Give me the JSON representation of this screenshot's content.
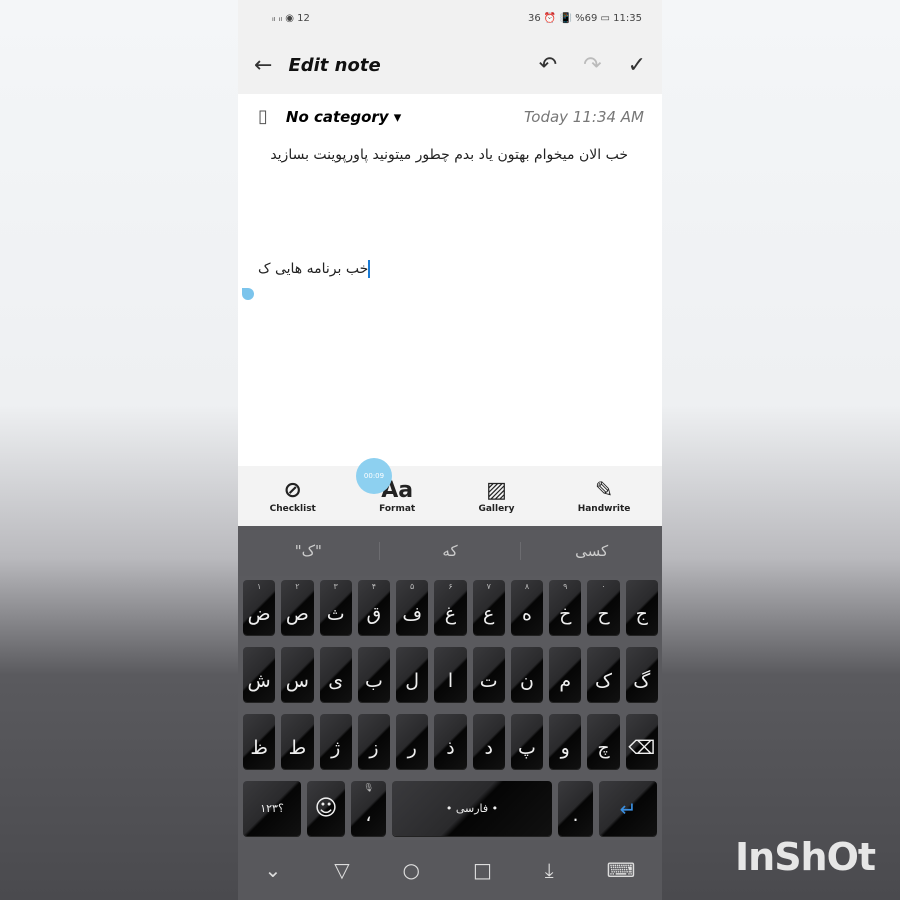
{
  "status": {
    "left": "ᵢₗ ᵢₗ ◉ 12",
    "right": "36 ⏰ 📳 %69 ▭ 11:35"
  },
  "toolbar": {
    "title": "Edit note",
    "back_icon": "arrow-left-icon",
    "undo_icon": "undo-icon",
    "redo_icon": "redo-icon",
    "save_icon": "check-icon"
  },
  "meta": {
    "category": "No category",
    "date": "Today 11:34 AM"
  },
  "note": {
    "line1": "خب الان میخوام بهتون یاد بدم چطور میتونید پاورپوینت بسازید",
    "line2": "خب برنامه هایی ک"
  },
  "tools": [
    {
      "label": "Checklist",
      "icon": "☑"
    },
    {
      "label": "Format",
      "icon": "Aa"
    },
    {
      "label": "Gallery",
      "icon": "🖼"
    },
    {
      "label": "Handwrite",
      "icon": "✎"
    }
  ],
  "bubble": "00:09",
  "suggestions": [
    "\"ک\"",
    "که",
    "کسی"
  ],
  "keyboard": {
    "row1": [
      {
        "k": "ض",
        "n": "۱"
      },
      {
        "k": "ص",
        "n": "۲"
      },
      {
        "k": "ث",
        "n": "۳"
      },
      {
        "k": "ق",
        "n": "۴"
      },
      {
        "k": "ف",
        "n": "۵"
      },
      {
        "k": "غ",
        "n": "۶"
      },
      {
        "k": "ع",
        "n": "۷"
      },
      {
        "k": "ه",
        "n": "۸"
      },
      {
        "k": "خ",
        "n": "۹"
      },
      {
        "k": "ح",
        "n": "۰"
      },
      {
        "k": "ج",
        "n": ""
      }
    ],
    "row2": [
      "ش",
      "س",
      "ی",
      "ب",
      "ل",
      "ا",
      "ت",
      "ن",
      "م",
      "ک",
      "گ"
    ],
    "row3": [
      "ظ",
      "ط",
      "ژ",
      "ز",
      "ر",
      "ذ",
      "د",
      "پ",
      "و",
      "چ",
      "⌫"
    ],
    "symbols": "؟۱۲۳",
    "emoji": "☺",
    "comma": "،",
    "space": "• فارسی •",
    "period": ".",
    "enter": "↵"
  },
  "watermark": "InShOt"
}
